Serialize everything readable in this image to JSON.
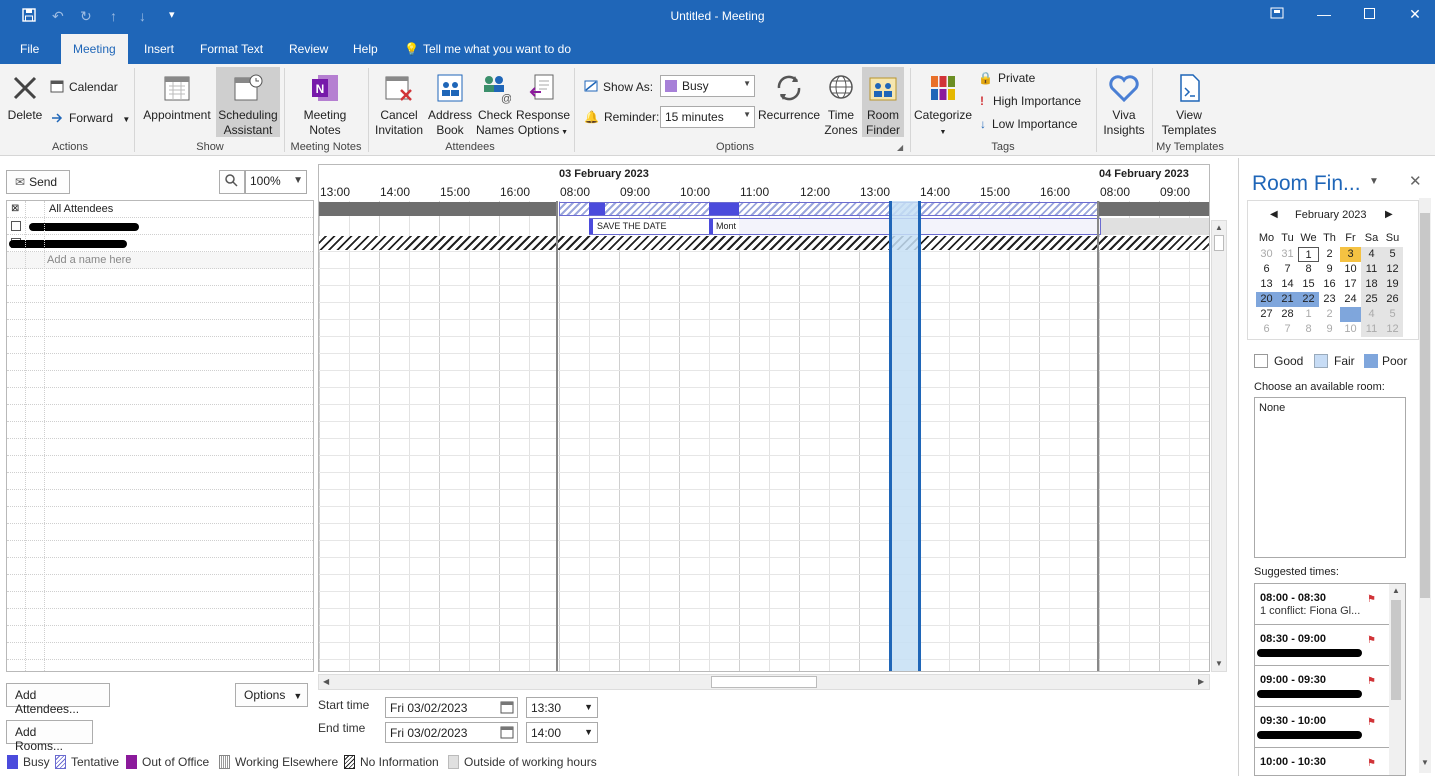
{
  "window": {
    "title": "Untitled  -  Meeting"
  },
  "tabs": [
    "File",
    "Meeting",
    "Insert",
    "Format Text",
    "Review",
    "Help"
  ],
  "tell_me": "Tell me what you want to do",
  "ribbon": {
    "actions": {
      "delete": "Delete",
      "calendar": "Calendar",
      "forward": "Forward",
      "label": "Actions"
    },
    "show": {
      "appointment": "Appointment",
      "scheduling_1": "Scheduling",
      "scheduling_2": "Assistant",
      "label": "Show"
    },
    "meeting_notes": {
      "btn_1": "Meeting",
      "btn_2": "Notes",
      "label": "Meeting Notes"
    },
    "attendees": {
      "cancel_1": "Cancel",
      "cancel_2": "Invitation",
      "address_1": "Address",
      "address_2": "Book",
      "check_1": "Check",
      "check_2": "Names",
      "response_1": "Response",
      "response_2": "Options",
      "label": "Attendees"
    },
    "options": {
      "show_as_label": "Show As:",
      "show_as_value": "Busy",
      "reminder_label": "Reminder:",
      "reminder_value": "15 minutes",
      "recurrence": "Recurrence",
      "time_1": "Time",
      "time_2": "Zones",
      "room_1": "Room",
      "room_2": "Finder",
      "label": "Options"
    },
    "tags": {
      "categorize": "Categorize",
      "private": "Private",
      "high": "High Importance",
      "low": "Low Importance",
      "label": "Tags"
    },
    "viva": {
      "btn_1": "Viva",
      "btn_2": "Insights"
    },
    "templates": {
      "btn_1": "View",
      "btn_2": "Templates",
      "label": "My Templates"
    }
  },
  "scheduling": {
    "send": "Send",
    "zoom": "100%",
    "all_attendees": "All Attendees",
    "add_name_placeholder": "Add a name here",
    "add_attendees": "Add Attendees...",
    "options": "Options",
    "add_rooms": "Add Rooms...",
    "date_1": "03 February 2023",
    "date_2": "04 February 2023",
    "hours_day1": [
      "13:00",
      "14:00",
      "15:00",
      "16:00"
    ],
    "hours_day2": [
      "08:00",
      "09:00",
      "10:00",
      "11:00",
      "12:00",
      "13:00",
      "14:00",
      "15:00",
      "16:00"
    ],
    "hours_day3": [
      "08:00",
      "09:00"
    ],
    "event_1": "SAVE THE DATE",
    "event_2": "Mont",
    "start_label": "Start time",
    "start_date": "Fri 03/02/2023",
    "start_time": "13:30",
    "end_label": "End time",
    "end_date": "Fri 03/02/2023",
    "end_time": "14:00"
  },
  "legend": {
    "busy": "Busy",
    "tentative": "Tentative",
    "oof": "Out of Office",
    "elsewhere": "Working Elsewhere",
    "noinfo": "No Information",
    "outside": "Outside of working hours"
  },
  "room_finder": {
    "title": "Room Fin...",
    "month": "February 2023",
    "weekdays": [
      "Mo",
      "Tu",
      "We",
      "Th",
      "Fr",
      "Sa",
      "Su"
    ],
    "weeks": [
      [
        "30",
        "31",
        "1",
        "2",
        "3",
        "4",
        "5"
      ],
      [
        "6",
        "7",
        "8",
        "9",
        "10",
        "11",
        "12"
      ],
      [
        "13",
        "14",
        "15",
        "16",
        "17",
        "18",
        "19"
      ],
      [
        "20",
        "21",
        "22",
        "23",
        "24",
        "25",
        "26"
      ],
      [
        "27",
        "28",
        "1",
        "2",
        "3",
        "4",
        "5"
      ],
      [
        "6",
        "7",
        "8",
        "9",
        "10",
        "11",
        "12"
      ]
    ],
    "good": "Good",
    "fair": "Fair",
    "poor": "Poor",
    "choose_room": "Choose an available room:",
    "room_none": "None",
    "suggested_label": "Suggested times:",
    "suggestions": [
      {
        "time": "08:00 - 08:30",
        "conflict": "1 conflict: Fiona Gl..."
      },
      {
        "time": "08:30 - 09:00"
      },
      {
        "time": "09:00 - 09:30"
      },
      {
        "time": "09:30 - 10:00"
      },
      {
        "time": "10:00 - 10:30"
      }
    ]
  },
  "colors": {
    "accent": "#1f66b8",
    "busy": "#4b4bdc",
    "oof": "#8b1a9b",
    "fair": "#c7dcf5",
    "poor": "#7fa6dc",
    "selection": "#c5dff5"
  }
}
